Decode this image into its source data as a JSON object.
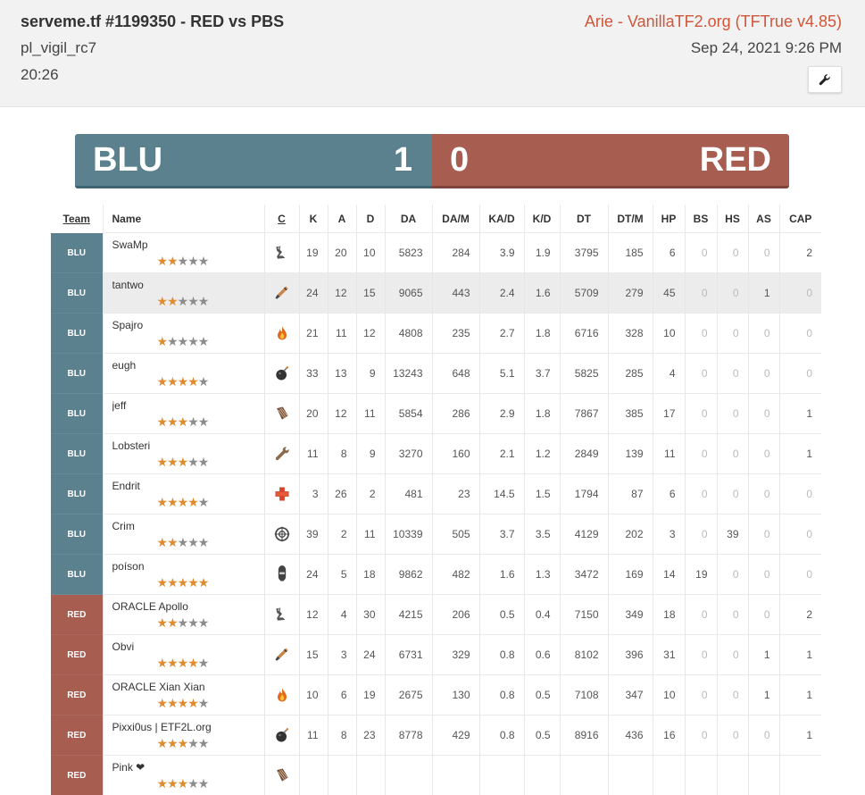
{
  "header": {
    "title": "serveme.tf #1199350 - RED vs PBS",
    "map": "pl_vigil_rc7",
    "duration": "20:26",
    "server": "Arie - VanillaTF2.org (TFTrue v4.85)",
    "date": "Sep 24, 2021 9:26 PM",
    "settings_icon": "wrench-icon"
  },
  "scoreboard": {
    "blu_label": "BLU",
    "blu_score": "1",
    "red_label": "RED",
    "red_score": "0",
    "colors": {
      "blu": "#5b818f",
      "red": "#a75d50",
      "stars": "#e08b2e"
    }
  },
  "table": {
    "columns": [
      "Team",
      "Name",
      "C",
      "K",
      "A",
      "D",
      "DA",
      "DA/M",
      "KA/D",
      "K/D",
      "DT",
      "DT/M",
      "HP",
      "BS",
      "HS",
      "AS",
      "CAP"
    ],
    "rows": [
      {
        "team": "BLU",
        "name": "SwaMp",
        "stars": 2,
        "cls": "scout",
        "k": "19",
        "a": "20",
        "d": "10",
        "da": "5823",
        "dam": "284",
        "kad": "3.9",
        "kd": "1.9",
        "dt": "3795",
        "dtm": "185",
        "hp": "6",
        "bs": "0",
        "hs": "0",
        "as": "0",
        "cap": "2"
      },
      {
        "team": "BLU",
        "name": "tantwo",
        "stars": 2,
        "cls": "soldier",
        "k": "24",
        "a": "12",
        "d": "15",
        "da": "9065",
        "dam": "443",
        "kad": "2.4",
        "kd": "1.6",
        "dt": "5709",
        "dtm": "279",
        "hp": "45",
        "bs": "0",
        "hs": "0",
        "as": "1",
        "cap": "0"
      },
      {
        "team": "BLU",
        "name": "Spajro",
        "stars": 1,
        "cls": "pyro",
        "k": "21",
        "a": "11",
        "d": "12",
        "da": "4808",
        "dam": "235",
        "kad": "2.7",
        "kd": "1.8",
        "dt": "6716",
        "dtm": "328",
        "hp": "10",
        "bs": "0",
        "hs": "0",
        "as": "0",
        "cap": "0"
      },
      {
        "team": "BLU",
        "name": "eugh",
        "stars": 4,
        "cls": "demoman",
        "k": "33",
        "a": "13",
        "d": "9",
        "da": "13243",
        "dam": "648",
        "kad": "5.1",
        "kd": "3.7",
        "dt": "5825",
        "dtm": "285",
        "hp": "4",
        "bs": "0",
        "hs": "0",
        "as": "0",
        "cap": "0"
      },
      {
        "team": "BLU",
        "name": "jeff",
        "stars": 3,
        "cls": "heavy",
        "k": "20",
        "a": "12",
        "d": "11",
        "da": "5854",
        "dam": "286",
        "kad": "2.9",
        "kd": "1.8",
        "dt": "7867",
        "dtm": "385",
        "hp": "17",
        "bs": "0",
        "hs": "0",
        "as": "0",
        "cap": "1"
      },
      {
        "team": "BLU",
        "name": "Lobsteri",
        "stars": 3,
        "cls": "engineer",
        "k": "11",
        "a": "8",
        "d": "9",
        "da": "3270",
        "dam": "160",
        "kad": "2.1",
        "kd": "1.2",
        "dt": "2849",
        "dtm": "139",
        "hp": "11",
        "bs": "0",
        "hs": "0",
        "as": "0",
        "cap": "1"
      },
      {
        "team": "BLU",
        "name": "Endrit",
        "stars": 4,
        "cls": "medic",
        "k": "3",
        "a": "26",
        "d": "2",
        "da": "481",
        "dam": "23",
        "kad": "14.5",
        "kd": "1.5",
        "dt": "1794",
        "dtm": "87",
        "hp": "6",
        "bs": "0",
        "hs": "0",
        "as": "0",
        "cap": "0"
      },
      {
        "team": "BLU",
        "name": "Crim",
        "stars": 2,
        "cls": "sniper",
        "k": "39",
        "a": "2",
        "d": "11",
        "da": "10339",
        "dam": "505",
        "kad": "3.7",
        "kd": "3.5",
        "dt": "4129",
        "dtm": "202",
        "hp": "3",
        "bs": "0",
        "hs": "39",
        "as": "0",
        "cap": "0"
      },
      {
        "team": "BLU",
        "name": "poíson",
        "stars": 5,
        "cls": "spy",
        "k": "24",
        "a": "5",
        "d": "18",
        "da": "9862",
        "dam": "482",
        "kad": "1.6",
        "kd": "1.3",
        "dt": "3472",
        "dtm": "169",
        "hp": "14",
        "bs": "19",
        "hs": "0",
        "as": "0",
        "cap": "0"
      },
      {
        "team": "RED",
        "name": "ORACLE Apollo",
        "stars": 2,
        "cls": "scout",
        "k": "12",
        "a": "4",
        "d": "30",
        "da": "4215",
        "dam": "206",
        "kad": "0.5",
        "kd": "0.4",
        "dt": "7150",
        "dtm": "349",
        "hp": "18",
        "bs": "0",
        "hs": "0",
        "as": "0",
        "cap": "2"
      },
      {
        "team": "RED",
        "name": "Obvi",
        "stars": 4,
        "cls": "soldier",
        "k": "15",
        "a": "3",
        "d": "24",
        "da": "6731",
        "dam": "329",
        "kad": "0.8",
        "kd": "0.6",
        "dt": "8102",
        "dtm": "396",
        "hp": "31",
        "bs": "0",
        "hs": "0",
        "as": "1",
        "cap": "1"
      },
      {
        "team": "RED",
        "name": "ORACLE Xian Xian",
        "stars": 4,
        "cls": "pyro",
        "k": "10",
        "a": "6",
        "d": "19",
        "da": "2675",
        "dam": "130",
        "kad": "0.8",
        "kd": "0.5",
        "dt": "7108",
        "dtm": "347",
        "hp": "10",
        "bs": "0",
        "hs": "0",
        "as": "1",
        "cap": "1"
      },
      {
        "team": "RED",
        "name": "Pixxi0us | ETF2L.org",
        "stars": 3,
        "cls": "demoman",
        "k": "11",
        "a": "8",
        "d": "23",
        "da": "8778",
        "dam": "429",
        "kad": "0.8",
        "kd": "0.5",
        "dt": "8916",
        "dtm": "436",
        "hp": "16",
        "bs": "0",
        "hs": "0",
        "as": "0",
        "cap": "1"
      },
      {
        "team": "RED",
        "name": "Pink ❤",
        "stars": 3,
        "cls": "heavy",
        "k": "",
        "a": "",
        "d": "",
        "da": "",
        "dam": "",
        "kad": "",
        "kd": "",
        "dt": "",
        "dtm": "",
        "hp": "",
        "bs": "",
        "hs": "",
        "as": "",
        "cap": ""
      }
    ]
  }
}
